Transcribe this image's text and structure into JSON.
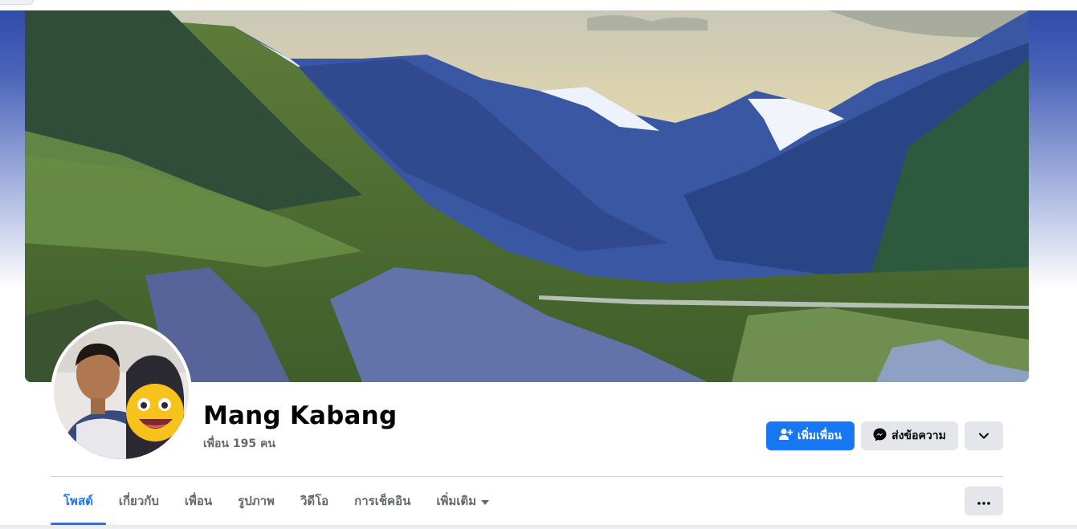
{
  "profile": {
    "name": "Mang Kabang",
    "friends_text": "เพื่อน 195 คน"
  },
  "actions": {
    "add_friend_label": "เพิ่มเพื่อน",
    "message_label": "ส่งข้อความ",
    "add_friend_icon": "person-add-icon",
    "message_icon": "messenger-icon",
    "dropdown_icon": "chevron-down-icon"
  },
  "tabs": [
    {
      "label": "โพสต์",
      "active": true
    },
    {
      "label": "เกี่ยวกับ",
      "active": false
    },
    {
      "label": "เพื่อน",
      "active": false
    },
    {
      "label": "รูปภาพ",
      "active": false
    },
    {
      "label": "วิดีโอ",
      "active": false
    },
    {
      "label": "การเช็คอิน",
      "active": false
    },
    {
      "label": "เพิ่มเติม",
      "active": false
    }
  ],
  "more_tab_icon": "caret-down-icon",
  "overflow_icon": "ellipsis-icon",
  "colors": {
    "accent": "#1877f2",
    "secondary_button": "#e4e6eb",
    "text_primary": "#050505",
    "text_secondary": "#65676b"
  }
}
